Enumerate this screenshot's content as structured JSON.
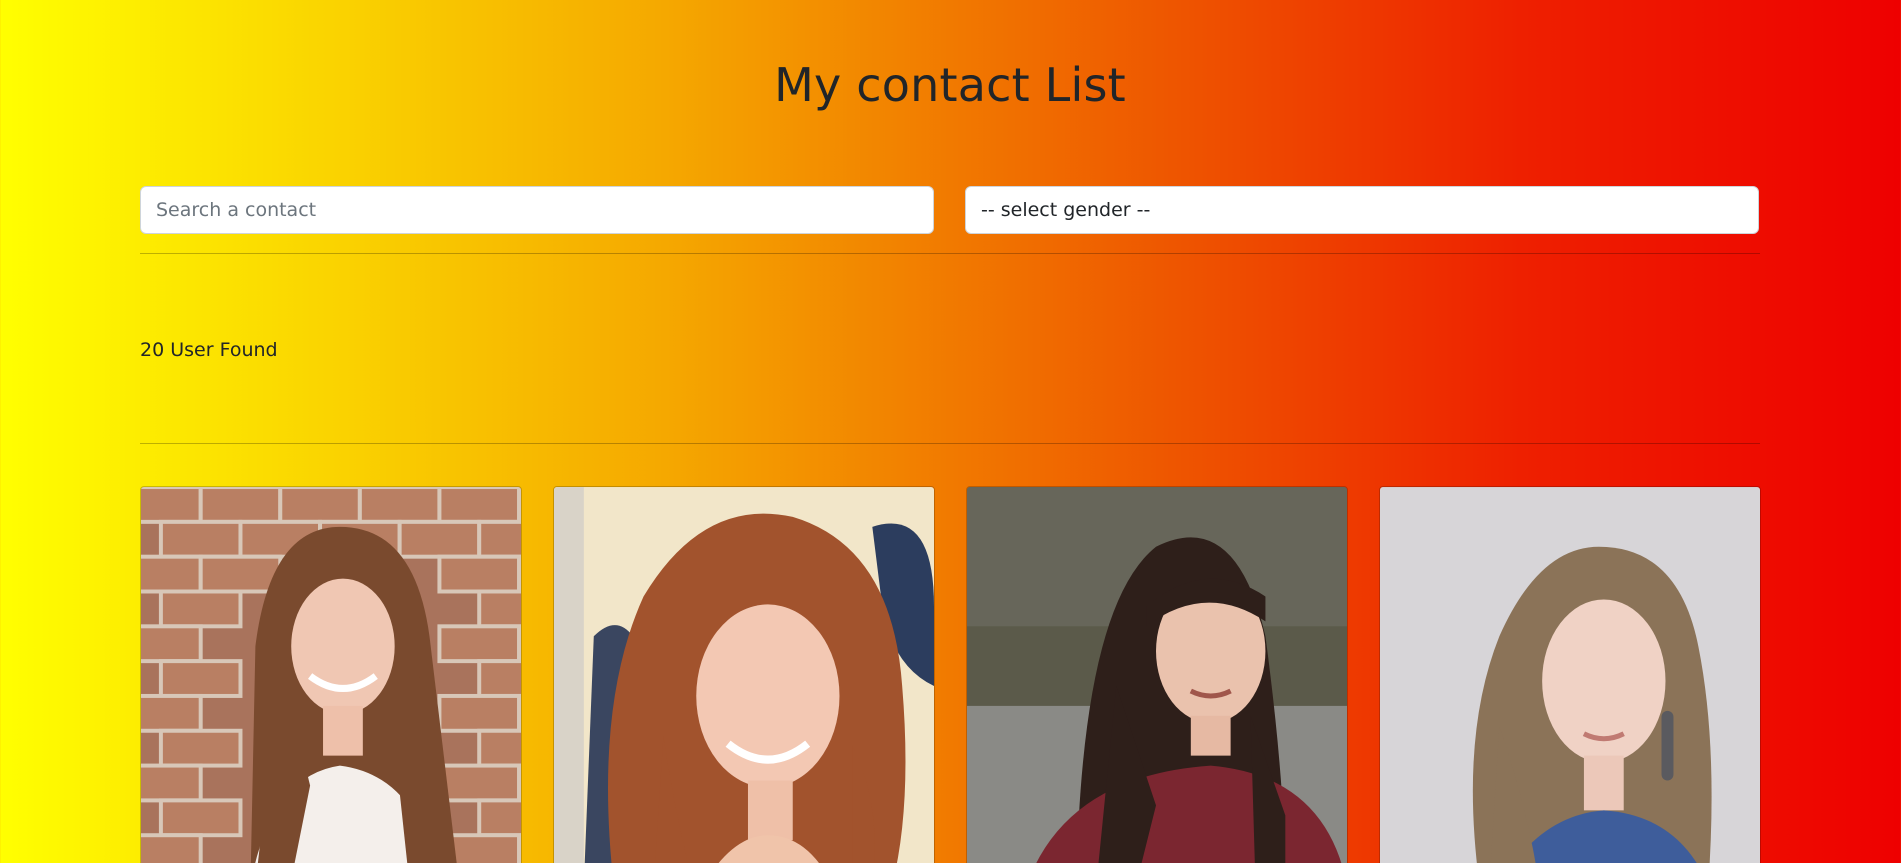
{
  "header": {
    "title": "My contact List"
  },
  "filters": {
    "search_placeholder": "Search a contact",
    "gender_selected": "-- select gender --"
  },
  "results": {
    "count_text": "20 User Found"
  },
  "contacts": [
    {
      "photo": "brick-wall-portrait"
    },
    {
      "photo": "curly-red-hair-portrait"
    },
    {
      "photo": "bangs-dark-hair-portrait"
    },
    {
      "photo": "wavy-hair-earring-portrait"
    }
  ],
  "colors": {
    "gradient_start": "#ffff00",
    "gradient_mid": "#f5a800",
    "gradient_end": "#ee0000",
    "text": "#212529"
  }
}
